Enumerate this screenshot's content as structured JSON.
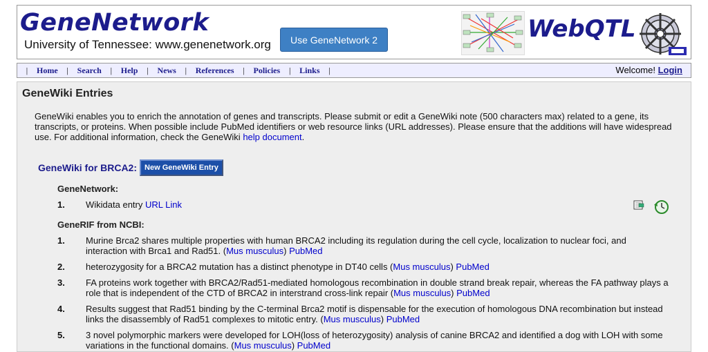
{
  "header": {
    "logo_title": "GeneNetwork",
    "logo_subtitle": "University of Tennessee:  www.genenetwork.org",
    "gn2_button": "Use GeneNetwork 2",
    "webqtl_title": "WebQTL"
  },
  "nav": {
    "items": [
      "Home",
      "Search",
      "Help",
      "News",
      "References",
      "Policies",
      "Links"
    ],
    "welcome_text": "Welcome!",
    "login_label": "Login"
  },
  "content": {
    "title": "GeneWiki Entries",
    "intro": "GeneWiki enables you to enrich the annotation of genes and transcripts. Please submit or edit a GeneWiki note (500 characters max) related to a gene, its transcripts, or proteins. When possible include PubMed identifiers or web resource links (URL addresses). Please ensure that the additions will have widespread use. For additional information, check the GeneWiki",
    "intro_link": "help document",
    "intro_end": ".",
    "brca_title": "GeneWiki for BRCA2:",
    "new_entry_button": "New GeneWiki Entry",
    "genenetwork_section": {
      "title": "GeneNetwork:",
      "entries": [
        {
          "num": "1.",
          "text": "Wikidata entry ",
          "link": "URL Link"
        }
      ]
    },
    "ncbi_section": {
      "title": "GeneRIF from NCBI:",
      "species_label": "Mus musculus",
      "pubmed_label": "PubMed",
      "entries": [
        {
          "num": "1.",
          "text": "Murine Brca2 shares multiple properties with human BRCA2 including its regulation during the cell cycle, localization to nuclear foci, and interaction with Brca1 and Rad51. ("
        },
        {
          "num": "2.",
          "text": "heterozygosity for a BRCA2 mutation has a distinct phenotype in DT40 cells ("
        },
        {
          "num": "3.",
          "text": "FA proteins work together with BRCA2/Rad51-mediated homologous recombination in double strand break repair, whereas the FA pathway plays a role that is independent of the CTD of BRCA2 in interstrand cross-link repair ("
        },
        {
          "num": "4.",
          "text": "Results suggest that Rad51 binding by the C-terminal Brca2 motif is dispensable for the execution of homologous DNA recombination but instead links the disassembly of Rad51 complexes to mitotic entry. ("
        },
        {
          "num": "5.",
          "text": "3 novel polymorphic markers were developed for LOH(loss of heterozygosity) analysis of canine BRCA2 and identified a dog with LOH with some variations in the functional domains. ("
        }
      ]
    }
  },
  "icons": {
    "edit": "edit-note-icon",
    "history": "history-icon",
    "wheel": "webqtl-wheel-icon",
    "network": "network-graph-icon"
  },
  "colors": {
    "brand": "#1c1c8c",
    "gn2_button": "#3e80c4",
    "nav_bg": "#eeeeff",
    "content_bg": "#eeeeee",
    "link": "#0000cc"
  }
}
